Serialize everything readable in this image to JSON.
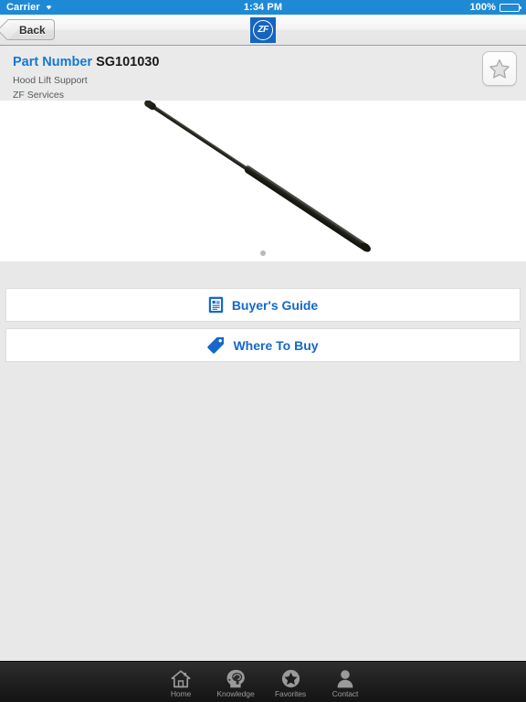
{
  "status_bar": {
    "carrier": "Carrier",
    "wifi_icon": "wifi-icon",
    "time": "1:34 PM",
    "battery_percent": "100%",
    "battery_icon": "battery-full-icon"
  },
  "nav_bar": {
    "back_label": "Back",
    "back_icon": "chevron-left-icon",
    "logo_text": "ZF",
    "logo_icon": "zf-logo-icon"
  },
  "part_header": {
    "label": "Part Number",
    "number": "SG101030",
    "description": "Hood Lift Support",
    "brand": "ZF Services",
    "favorite_icon": "star-outline-icon"
  },
  "product_image": {
    "alt": "Hood Lift Support gas strut",
    "page_dots": 1,
    "active_dot": 0
  },
  "actions": [
    {
      "label": "Buyer's Guide",
      "icon": "document-icon"
    },
    {
      "label": "Where To Buy",
      "icon": "tag-icon"
    }
  ],
  "tab_bar": {
    "items": [
      {
        "label": "Home",
        "icon": "home-icon"
      },
      {
        "label": "Knowledge",
        "icon": "head-brain-icon"
      },
      {
        "label": "Favorites",
        "icon": "star-circle-icon"
      },
      {
        "label": "Contact",
        "icon": "person-icon"
      }
    ]
  },
  "colors": {
    "status_bar": "#1e8ad6",
    "accent_blue": "#1568c9",
    "link_blue": "#1678d4",
    "logo_blue": "#1565c0",
    "page_bg": "#e8e8e8",
    "tab_bar": "#1d1d1d"
  }
}
